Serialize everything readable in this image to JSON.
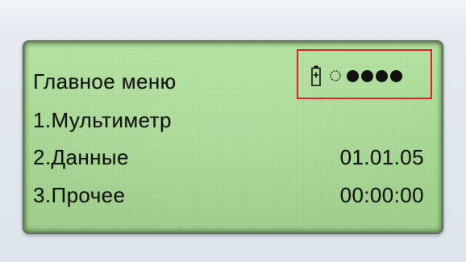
{
  "screen": {
    "title": "Главное меню",
    "menu": [
      {
        "label": "1.Мультиметр",
        "value": ""
      },
      {
        "label": "2.Данные",
        "value": "01.01.05"
      },
      {
        "label": "3.Прочее",
        "value": "00:00:00"
      }
    ]
  },
  "status": {
    "battery_icon": "battery-charging-icon",
    "signal_level": {
      "filled": 4,
      "total": 5
    },
    "highlight_color": "#e0212a"
  },
  "colors": {
    "lcd_background": "#b2df9f",
    "lcd_text": "#141414",
    "bezel": "#6f8663"
  }
}
